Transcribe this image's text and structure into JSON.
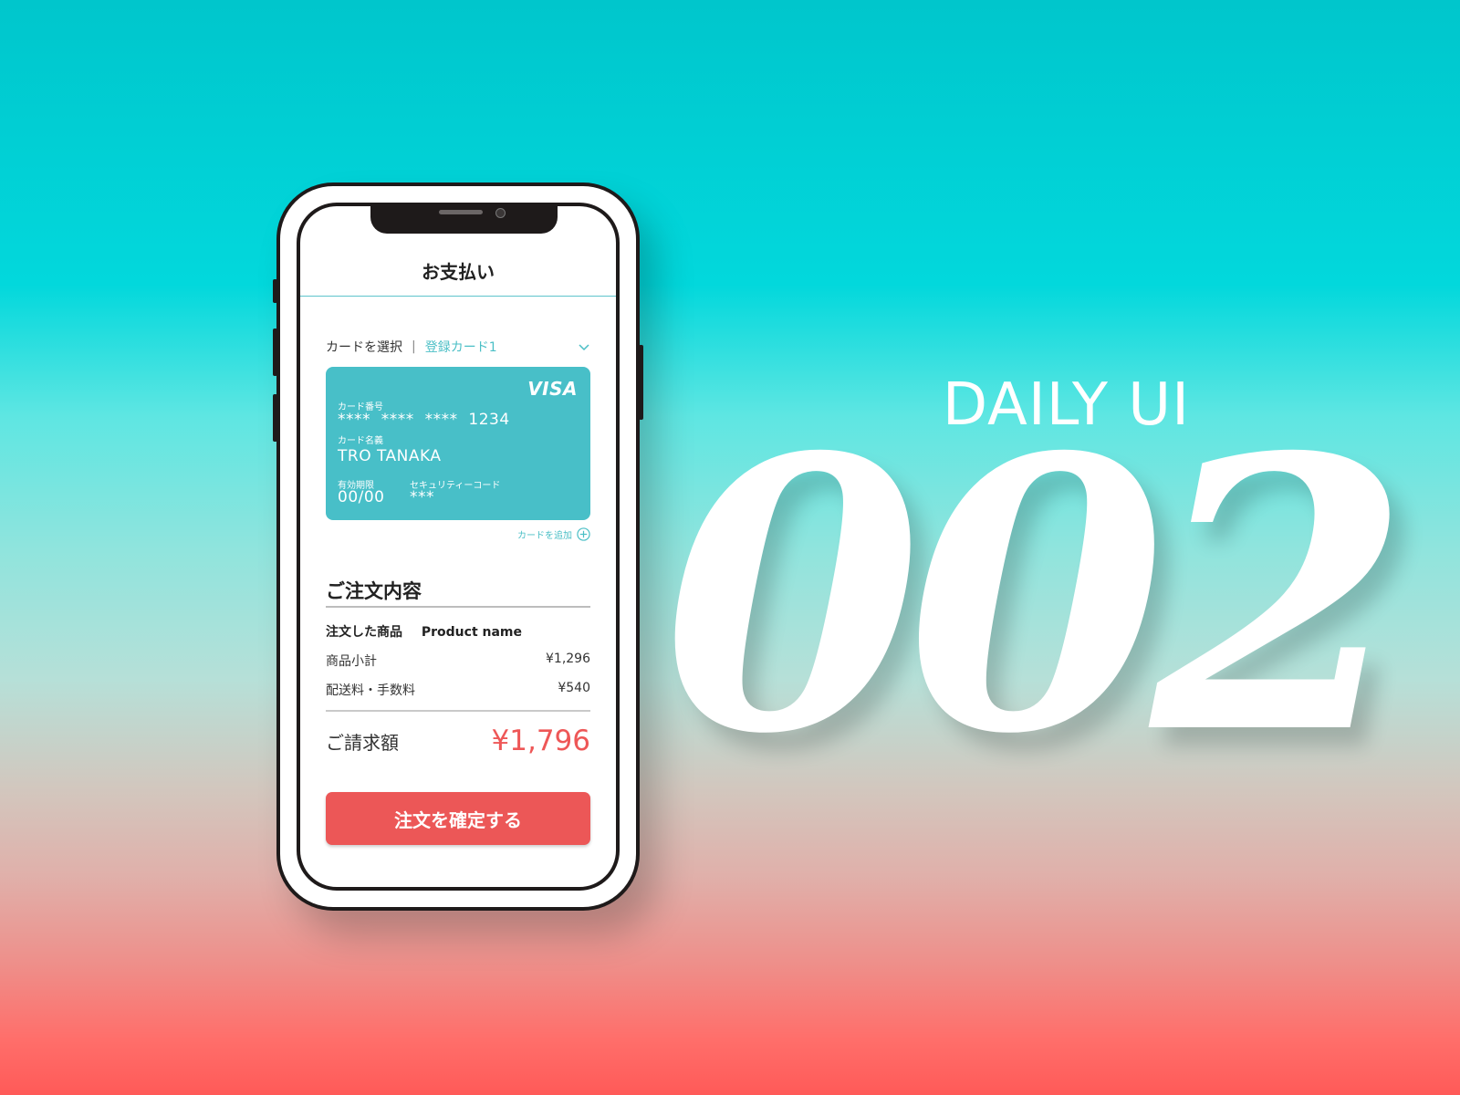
{
  "screen": {
    "title": "お支払い"
  },
  "card_select": {
    "label": "カードを選択",
    "separator": "|",
    "selected": "登録カード1",
    "dropdown_icon": "chevron-down-icon"
  },
  "card": {
    "brand": "VISA",
    "number_label": "カード番号",
    "number": "****  ****  ****  1234",
    "holder_label": "カード名義",
    "holder": "TRO TANAKA",
    "expiry_label": "有効期限",
    "expiry": "00/00",
    "cvc_label": "セキュリティーコード",
    "cvc": "***",
    "color": "#48bfc8"
  },
  "add_card": {
    "label": "カードを追加",
    "icon": "plus-circle-icon"
  },
  "order": {
    "title": "ご注文内容",
    "product_label": "注文した商品",
    "product_name": "Product name",
    "subtotal_label": "商品小計",
    "subtotal_value": "¥1,296",
    "fee_label": "配送料・手数料",
    "fee_value": "¥540",
    "total_label": "ご請求額",
    "total_value": "¥1,796"
  },
  "confirm_button": {
    "label": "注文を確定する"
  },
  "hero": {
    "daily_ui": "DAILY UI",
    "number": "002"
  },
  "colors": {
    "accent": "#4bbfc6",
    "cta": "#ec5757",
    "total": "#ee5757"
  }
}
